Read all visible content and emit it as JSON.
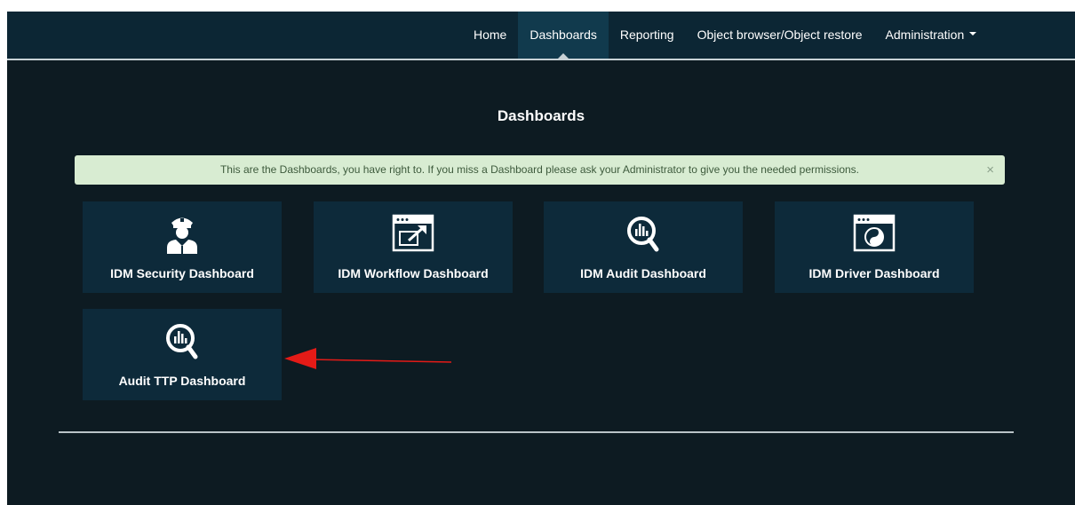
{
  "nav": {
    "items": [
      {
        "label": "Home",
        "active": false
      },
      {
        "label": "Dashboards",
        "active": true
      },
      {
        "label": "Reporting",
        "active": false
      },
      {
        "label": "Object browser/Object restore",
        "active": false
      },
      {
        "label": "Administration",
        "active": false,
        "dropdown": true
      }
    ]
  },
  "page": {
    "title": "Dashboards"
  },
  "alert": {
    "text": "This are the Dashboards, you have right to. If you miss a Dashboard please ask your Administrator to give you the needed permissions.",
    "close": "×"
  },
  "tiles": [
    {
      "label": "IDM Security Dashboard",
      "icon": "security-officer-icon"
    },
    {
      "label": "IDM Workflow Dashboard",
      "icon": "workflow-window-icon"
    },
    {
      "label": "IDM Audit Dashboard",
      "icon": "audit-magnifier-chart-icon"
    },
    {
      "label": "IDM Driver Dashboard",
      "icon": "yin-yang-window-icon"
    },
    {
      "label": "Audit TTP Dashboard",
      "icon": "audit-magnifier-chart-icon"
    }
  ],
  "colors": {
    "background": "#0d1b22",
    "navbar": "#0c2634",
    "tile": "#0d2a3a",
    "alert": "#d8ecd2",
    "annotation": "#e41b17"
  }
}
